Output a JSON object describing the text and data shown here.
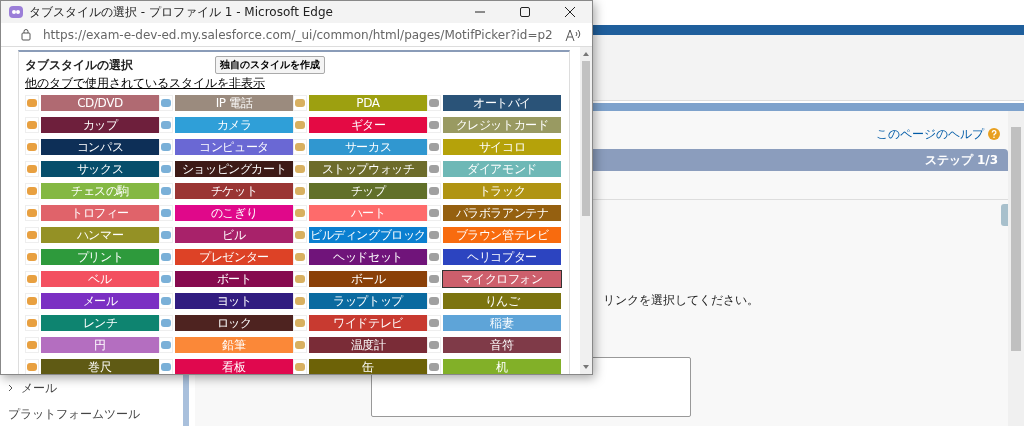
{
  "popup": {
    "title": "タブスタイルの選択 - プロファイル 1 - Microsoft Edge",
    "url": "https://exam-e-dev-ed.my.salesforce.com/_ui/common/html/pages/MotifPicker?id=p2",
    "heading": "タブスタイルの選択",
    "create_button": "独自のスタイルを作成",
    "hide_link": "他のタブで使用されているスタイルを非表示",
    "styles": [
      {
        "label": "CD/DVD",
        "color": "#b06a72",
        "selected": false
      },
      {
        "label": "IP 電話",
        "color": "#9b8b7e",
        "selected": false
      },
      {
        "label": "PDA",
        "color": "#9da010",
        "selected": false
      },
      {
        "label": "オートバイ",
        "color": "#2a5378",
        "selected": false
      },
      {
        "label": "カップ",
        "color": "#6e1f3c",
        "selected": false
      },
      {
        "label": "カメラ",
        "color": "#2f9fd8",
        "selected": false
      },
      {
        "label": "ギター",
        "color": "#e40a44",
        "selected": false
      },
      {
        "label": "クレジットカード",
        "color": "#999a62",
        "selected": false
      },
      {
        "label": "コンパス",
        "color": "#0d2f57",
        "selected": false
      },
      {
        "label": "コンピュータ",
        "color": "#6a68d4",
        "selected": false
      },
      {
        "label": "サーカス",
        "color": "#3097d0",
        "selected": false
      },
      {
        "label": "サイコロ",
        "color": "#b5a20a",
        "selected": false
      },
      {
        "label": "サックス",
        "color": "#064e6b",
        "selected": false
      },
      {
        "label": "ショッピングカート",
        "color": "#3d1a16",
        "selected": false
      },
      {
        "label": "ストップウォッチ",
        "color": "#6d6c2b",
        "selected": false
      },
      {
        "label": "ダイアモンド",
        "color": "#6eb8b6",
        "selected": false
      },
      {
        "label": "チェスの駒",
        "color": "#84b843",
        "selected": false
      },
      {
        "label": "チケット",
        "color": "#9a3534",
        "selected": false
      },
      {
        "label": "チップ",
        "color": "#617029",
        "selected": false
      },
      {
        "label": "トラック",
        "color": "#b09413",
        "selected": false
      },
      {
        "label": "トロフィー",
        "color": "#e0636a",
        "selected": false
      },
      {
        "label": "のこぎり",
        "color": "#e0088a",
        "selected": false
      },
      {
        "label": "ハート",
        "color": "#fe6b6b",
        "selected": false
      },
      {
        "label": "パラボラアンテナ",
        "color": "#956010",
        "selected": false
      },
      {
        "label": "ハンマー",
        "color": "#949125",
        "selected": false
      },
      {
        "label": "ビル",
        "color": "#a8226a",
        "selected": false
      },
      {
        "label": "ビルディングブロック",
        "color": "#0a7fd0",
        "selected": false
      },
      {
        "label": "ブラウン管テレビ",
        "color": "#f86b0e",
        "selected": false
      },
      {
        "label": "プリント",
        "color": "#2e9a3c",
        "selected": false
      },
      {
        "label": "プレゼンター",
        "color": "#dd4226",
        "selected": false
      },
      {
        "label": "ヘッドセット",
        "color": "#70147a",
        "selected": false
      },
      {
        "label": "ヘリコプター",
        "color": "#2c44c0",
        "selected": false
      },
      {
        "label": "ベル",
        "color": "#f35060",
        "selected": false
      },
      {
        "label": "ボート",
        "color": "#860a4e",
        "selected": false
      },
      {
        "label": "ボール",
        "color": "#8a4008",
        "selected": false
      },
      {
        "label": "マイクロフォン",
        "color": "#cd5f6c",
        "selected": true
      },
      {
        "label": "メール",
        "color": "#7b2fc3",
        "selected": false
      },
      {
        "label": "ヨット",
        "color": "#311c80",
        "selected": false
      },
      {
        "label": "ラップトップ",
        "color": "#0a6aa0",
        "selected": false
      },
      {
        "label": "りんご",
        "color": "#7c7410",
        "selected": false
      },
      {
        "label": "レンチ",
        "color": "#0e8470",
        "selected": false
      },
      {
        "label": "ロック",
        "color": "#4e2320",
        "selected": false
      },
      {
        "label": "ワイドテレビ",
        "color": "#c83a30",
        "selected": false
      },
      {
        "label": "稲妻",
        "color": "#5ea4d8",
        "selected": false
      },
      {
        "label": "円",
        "color": "#b46ec0",
        "selected": false
      },
      {
        "label": "鉛筆",
        "color": "#fb8838",
        "selected": false
      },
      {
        "label": "温度計",
        "color": "#7a2c37",
        "selected": false
      },
      {
        "label": "音符",
        "color": "#7f3a48",
        "selected": false
      },
      {
        "label": "巻尺",
        "color": "#5f5a14",
        "selected": false
      },
      {
        "label": "看板",
        "color": "#e0084e",
        "selected": false
      },
      {
        "label": "缶",
        "color": "#6d6207",
        "selected": false
      },
      {
        "label": "机",
        "color": "#82b028",
        "selected": false
      }
    ]
  },
  "page": {
    "help_link": "このページのヘルプ",
    "step": "ステップ 1/3",
    "instruction": "リンクを選択してください。",
    "sidebar": [
      {
        "label": "メール"
      },
      {
        "label": "プラットフォームツール"
      }
    ]
  }
}
